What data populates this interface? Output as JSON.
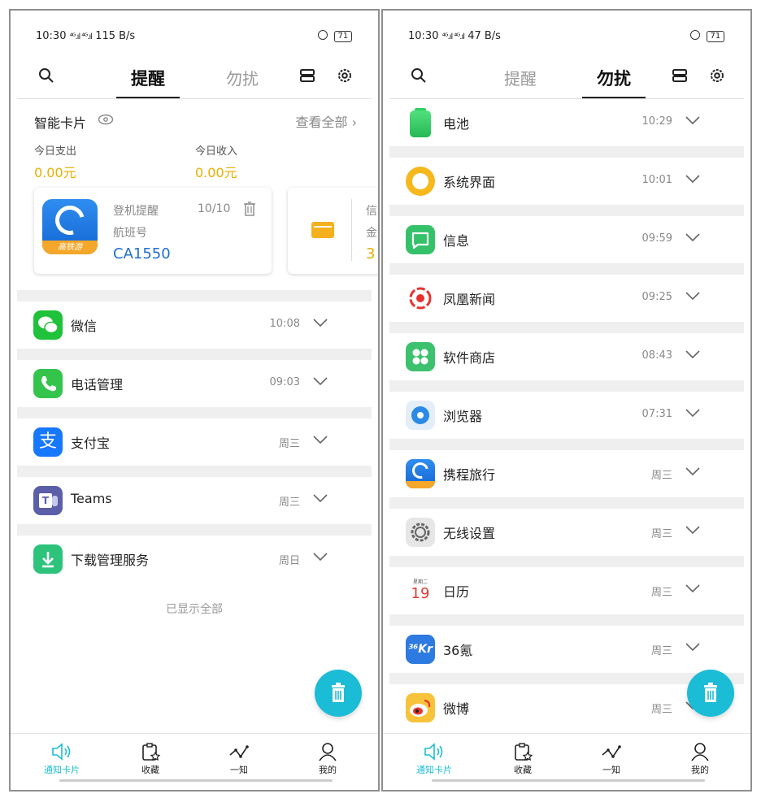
{
  "left": {
    "status": {
      "time": "10:30",
      "signal": "⁴ᴳ.ıl ⁴ᴳ.ıl",
      "speed": "115 B/s",
      "battery": "71"
    },
    "tabs": {
      "remind": "提醒",
      "nodisturb": "勿扰"
    },
    "smart_card": {
      "title": "智能卡片",
      "view_all": "查看全部 ›",
      "spend_label": "今日支出",
      "spend_value": "0.00元",
      "income_label": "今日收入",
      "income_value": "0.00元",
      "flight": {
        "app_label": "高铁游",
        "type": "登机提醒",
        "date": "10/10",
        "field": "航班号",
        "number": "CA1550"
      },
      "second_card": {
        "c1": "信",
        "c2": "金",
        "c3": "3"
      }
    },
    "apps": [
      {
        "name": "微信",
        "time": "10:08"
      },
      {
        "name": "电话管理",
        "time": "09:03"
      },
      {
        "name": "支付宝",
        "time": "周三"
      },
      {
        "name": "Teams",
        "time": "周三"
      },
      {
        "name": "下载管理服务",
        "time": "周日"
      }
    ],
    "footer": "已显示全部"
  },
  "right": {
    "status": {
      "time": "10:30",
      "signal": "⁴ᴳ.ıl ⁴ᴳ.ıl",
      "speed": "47 B/s",
      "battery": "71"
    },
    "tabs": {
      "remind": "提醒",
      "nodisturb": "勿扰"
    },
    "apps": [
      {
        "name": "电池",
        "time": "10:29"
      },
      {
        "name": "系统界面",
        "time": "10:01"
      },
      {
        "name": "信息",
        "time": "09:59"
      },
      {
        "name": "凤凰新闻",
        "time": "09:25"
      },
      {
        "name": "软件商店",
        "time": "08:43"
      },
      {
        "name": "浏览器",
        "time": "07:31"
      },
      {
        "name": "携程旅行",
        "time": "周三"
      },
      {
        "name": "无线设置",
        "time": "周三"
      },
      {
        "name": "日历",
        "time": "周三"
      },
      {
        "name": "36氪",
        "time": "周三"
      },
      {
        "name": "微博",
        "time": "周三"
      }
    ],
    "calendar_icon": {
      "weekday": "星期二",
      "day": "19"
    },
    "kr_icon": "³⁶Kr"
  },
  "nav": [
    {
      "label": "通知卡片",
      "icon": "speaker-icon"
    },
    {
      "label": "收藏",
      "icon": "clipboard-star-icon"
    },
    {
      "label": "一知",
      "icon": "constellation-icon"
    },
    {
      "label": "我的",
      "icon": "person-icon"
    }
  ],
  "colors": {
    "accent": "#1bbcd6",
    "amount": "#e9b000",
    "flight_number": "#1e6fd0"
  }
}
